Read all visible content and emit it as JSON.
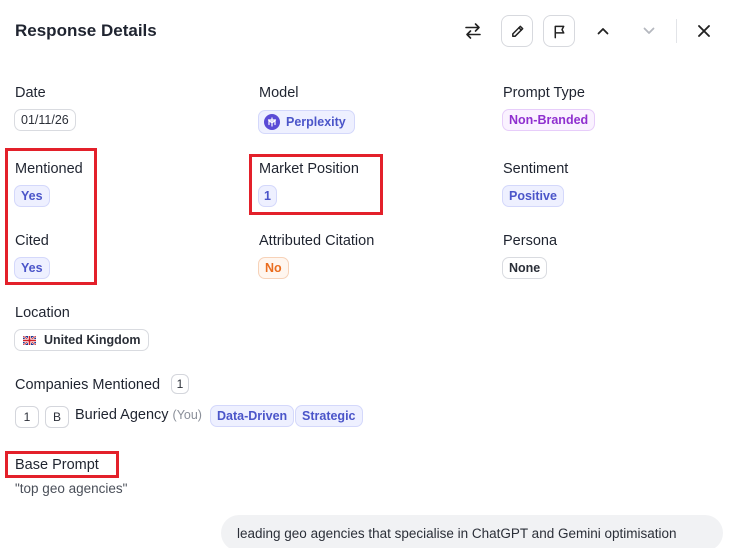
{
  "header": {
    "title": "Response Details"
  },
  "fields": {
    "date": {
      "label": "Date",
      "value": "01/11/26"
    },
    "model": {
      "label": "Model",
      "value": "Perplexity"
    },
    "prompt_type": {
      "label": "Prompt Type",
      "value": "Non-Branded"
    },
    "mentioned": {
      "label": "Mentioned",
      "value": "Yes"
    },
    "market_position": {
      "label": "Market Position",
      "value": "1"
    },
    "sentiment": {
      "label": "Sentiment",
      "value": "Positive"
    },
    "cited": {
      "label": "Cited",
      "value": "Yes"
    },
    "attributed_citation": {
      "label": "Attributed Citation",
      "value": "No"
    },
    "persona": {
      "label": "Persona",
      "value": "None"
    },
    "location": {
      "label": "Location",
      "value": "United Kingdom"
    }
  },
  "companies": {
    "label": "Companies Mentioned",
    "count": "1",
    "items": [
      {
        "rank": "1",
        "initial": "B",
        "name": "Buried Agency",
        "you": "(You)",
        "tags": [
          "Data-Driven",
          "Strategic"
        ]
      }
    ]
  },
  "base_prompt": {
    "label": "Base Prompt",
    "text": "\"top geo agencies\""
  },
  "message": {
    "text": "leading geo agencies that specialise in ChatGPT and Gemini optimisation"
  },
  "colors": {
    "highlight_box": "#e3202a",
    "blue_chip": "#4b55c9",
    "purple_chip": "#8f2fcf",
    "orange_chip": "#ea6c1e"
  }
}
